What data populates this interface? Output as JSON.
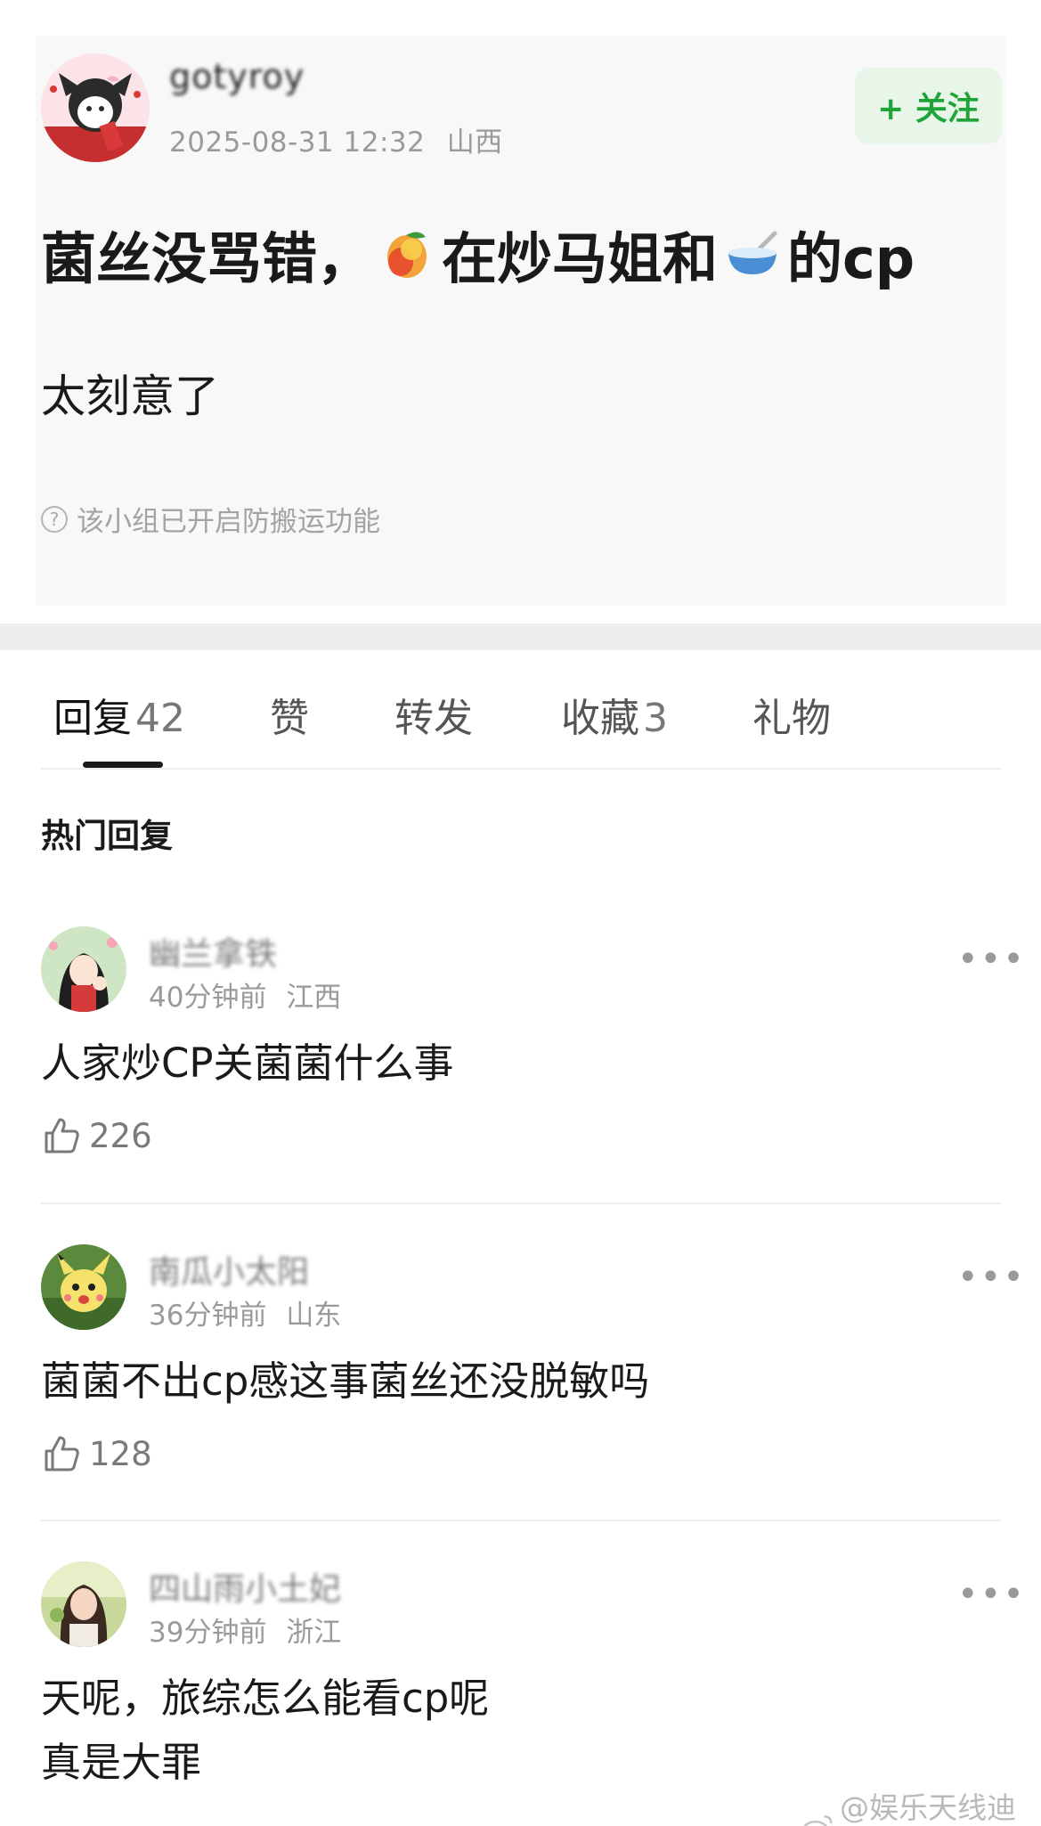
{
  "post": {
    "author_name": "gotyroy",
    "timestamp": "2025-08-31 12:32",
    "location": "山西",
    "follow_label": "+ 关注",
    "title_parts": [
      "菌丝没骂错，",
      "在炒马姐和",
      "的cp"
    ],
    "title_emojis": [
      "mango-emoji",
      "bowl-emoji"
    ],
    "body": "太刻意了",
    "anti_copy_notice": "该小组已开启防搬运功能"
  },
  "tabs": [
    {
      "label": "回复",
      "count": "42",
      "active": true
    },
    {
      "label": "赞",
      "count": "",
      "active": false
    },
    {
      "label": "转发",
      "count": "",
      "active": false
    },
    {
      "label": "收藏",
      "count": "3",
      "active": false
    },
    {
      "label": "礼物",
      "count": "",
      "active": false
    }
  ],
  "hot_heading": "热门回复",
  "comments": [
    {
      "name": "幽兰拿铁",
      "time": "40分钟前",
      "location": "江西",
      "text_lines": [
        "人家炒CP关菌菌什么事"
      ],
      "likes": "226"
    },
    {
      "name": "南瓜小太阳",
      "time": "36分钟前",
      "location": "山东",
      "text_lines": [
        "菌菌不出cp感这事菌丝还没脱敏吗"
      ],
      "likes": "128"
    },
    {
      "name": "四山雨小土妃",
      "time": "39分钟前",
      "location": "浙江",
      "text_lines": [
        "天呢，旅综怎么能看cp呢",
        "真是大罪"
      ],
      "likes": ""
    }
  ],
  "more_icon": "more-dots-icon",
  "credit": "@娱乐天线迪西",
  "colors": {
    "follow_green": "#20a43a",
    "follow_bg": "#e8f6ea",
    "meta_gray": "#9a9a9a",
    "divider": "#eeeeee"
  }
}
